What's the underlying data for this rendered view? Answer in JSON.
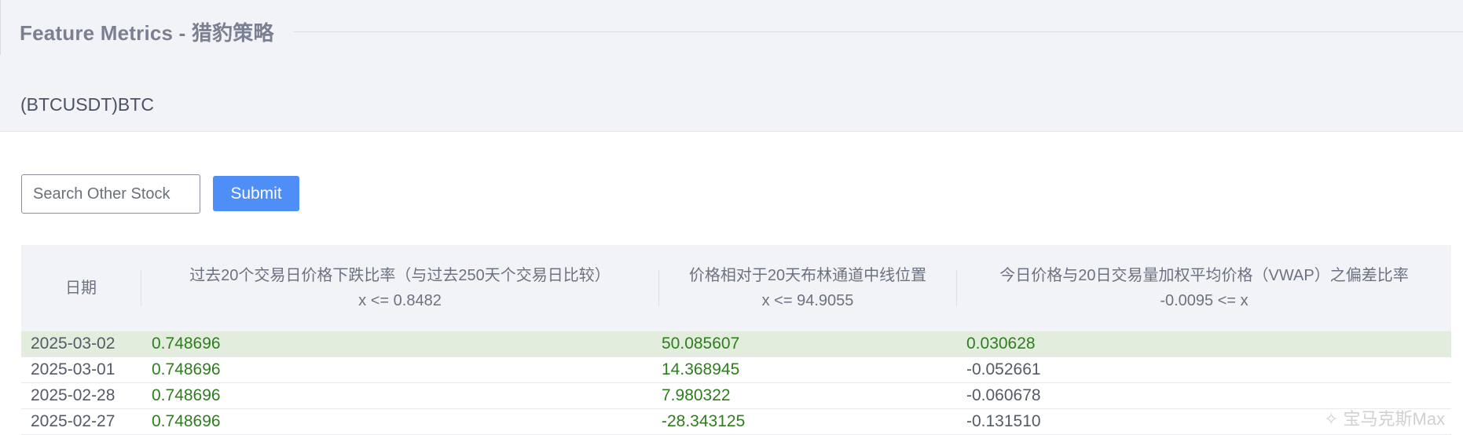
{
  "header": {
    "title": "Feature Metrics - 猎豹策略",
    "symbol": "(BTCUSDT)BTC"
  },
  "search": {
    "placeholder": "Search Other Stock",
    "value": "",
    "submit_label": "Submit"
  },
  "table": {
    "columns": [
      {
        "label": "日期",
        "condition": ""
      },
      {
        "label": "过去20个交易日价格下跌比率（与过去250天个交易日比较）",
        "condition": "x <= 0.8482"
      },
      {
        "label": "价格相对于20天布林通道中线位置",
        "condition": "x <= 94.9055"
      },
      {
        "label": "今日价格与20日交易量加权平均价格（VWAP）之偏差比率",
        "condition": "-0.0095 <= x"
      }
    ],
    "rows": [
      {
        "date": "2025-03-02",
        "v1": "0.748696",
        "v2": "50.085607",
        "v3": "0.030628",
        "pass": [
          true,
          true,
          true
        ],
        "highlight": true
      },
      {
        "date": "2025-03-01",
        "v1": "0.748696",
        "v2": "14.368945",
        "v3": "-0.052661",
        "pass": [
          true,
          true,
          false
        ],
        "highlight": false
      },
      {
        "date": "2025-02-28",
        "v1": "0.748696",
        "v2": "7.980322",
        "v3": "-0.060678",
        "pass": [
          true,
          true,
          false
        ],
        "highlight": false
      },
      {
        "date": "2025-02-27",
        "v1": "0.748696",
        "v2": "-28.343125",
        "v3": "-0.131510",
        "pass": [
          true,
          true,
          false
        ],
        "highlight": false
      }
    ]
  },
  "colors": {
    "pass": "#2e7d1e",
    "fail": "#555b66",
    "highlight_row": "#e2eddd",
    "button": "#4f8ef6"
  },
  "watermark": "✧ 宝马克斯Max"
}
